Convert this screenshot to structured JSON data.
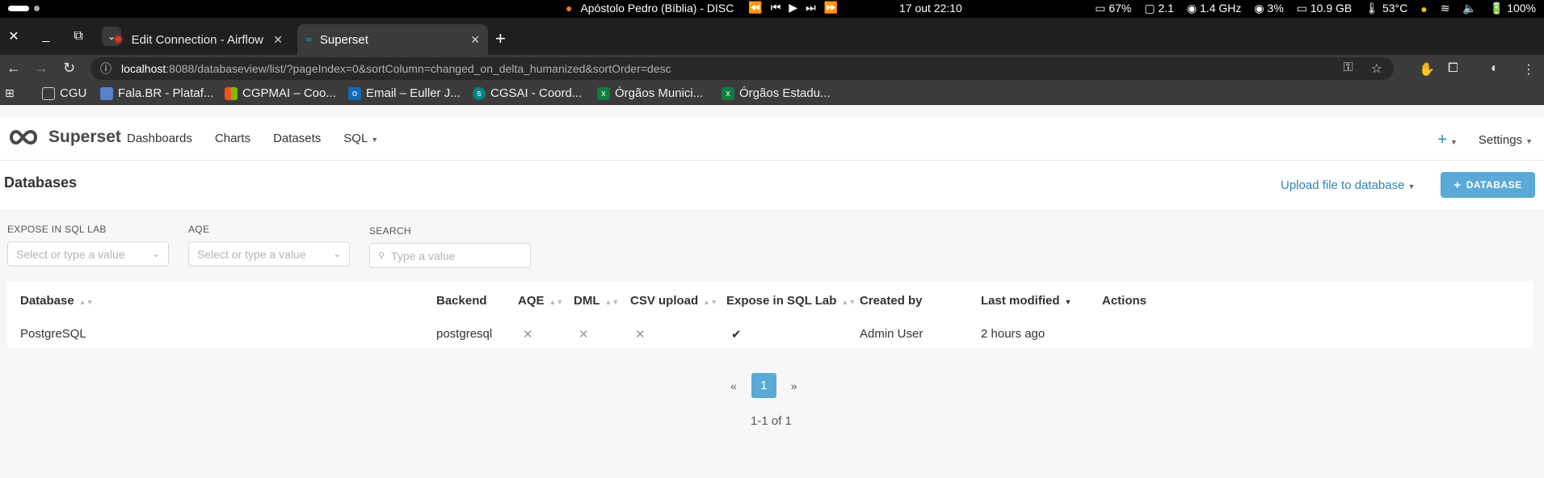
{
  "os_bar": {
    "media_title": "Apóstolo Pedro (Bíblia) - DISC",
    "clock": "17 out  22:10",
    "battery": "67%",
    "load": "2.1",
    "cpu_freq": "1.4 GHz",
    "cpu": "3%",
    "memory": "10.9 GB",
    "temp": "53°C",
    "volume": "100%"
  },
  "tabs": [
    {
      "title": "Edit Connection - Airflow",
      "active": false
    },
    {
      "title": "Superset",
      "active": true
    }
  ],
  "address": {
    "host": "localhost",
    "rest": ":8088/databaseview/list/?pageIndex=0&sortColumn=changed_on_delta_humanized&sortOrder=desc"
  },
  "bookmarks": [
    {
      "label": "CGU",
      "icon": "folder-icon",
      "color": "#cccccc"
    },
    {
      "label": "Fala.BR - Plataf...",
      "icon": "page-icon",
      "color": "#5a7fd0"
    },
    {
      "label": "CGPMAI – Coo...",
      "icon": "microsoft-icon",
      "color": "#f25022"
    },
    {
      "label": "Email – Euller J...",
      "icon": "outlook-icon",
      "color": "#0f6cbd"
    },
    {
      "label": "CGSAI - Coord...",
      "icon": "sharepoint-icon",
      "color": "#038387"
    },
    {
      "label": "Órgãos Munici...",
      "icon": "excel-icon",
      "color": "#107c41"
    },
    {
      "label": "Órgãos Estadu...",
      "icon": "excel-icon",
      "color": "#107c41"
    }
  ],
  "app": {
    "brand": "Superset",
    "nav": [
      "Dashboards",
      "Charts",
      "Datasets",
      "SQL"
    ],
    "plus": "+",
    "settings": "Settings",
    "page_title": "Databases",
    "upload_label": "Upload file to database",
    "add_db_label": "DATABASE",
    "accent": "#5aa9d6"
  },
  "filters": {
    "expose_label": "EXPOSE IN SQL LAB",
    "expose_placeholder": "Select or type a value",
    "aqe_label": "AQE",
    "aqe_placeholder": "Select or type a value",
    "search_label": "SEARCH",
    "search_placeholder": "Type a value"
  },
  "table": {
    "headers": [
      "Database",
      "Backend",
      "AQE",
      "DML",
      "CSV upload",
      "Expose in SQL Lab",
      "Created by",
      "Last modified",
      "Actions"
    ],
    "row": {
      "database": "PostgreSQL",
      "backend": "postgresql",
      "aqe": "✕",
      "dml": "✕",
      "csv": "✕",
      "expose": "✔",
      "created_by": "Admin User",
      "last_modified": "2 hours ago"
    }
  },
  "pagination": {
    "prev": "«",
    "current": "1",
    "next": "»",
    "info": "1-1 of 1"
  }
}
